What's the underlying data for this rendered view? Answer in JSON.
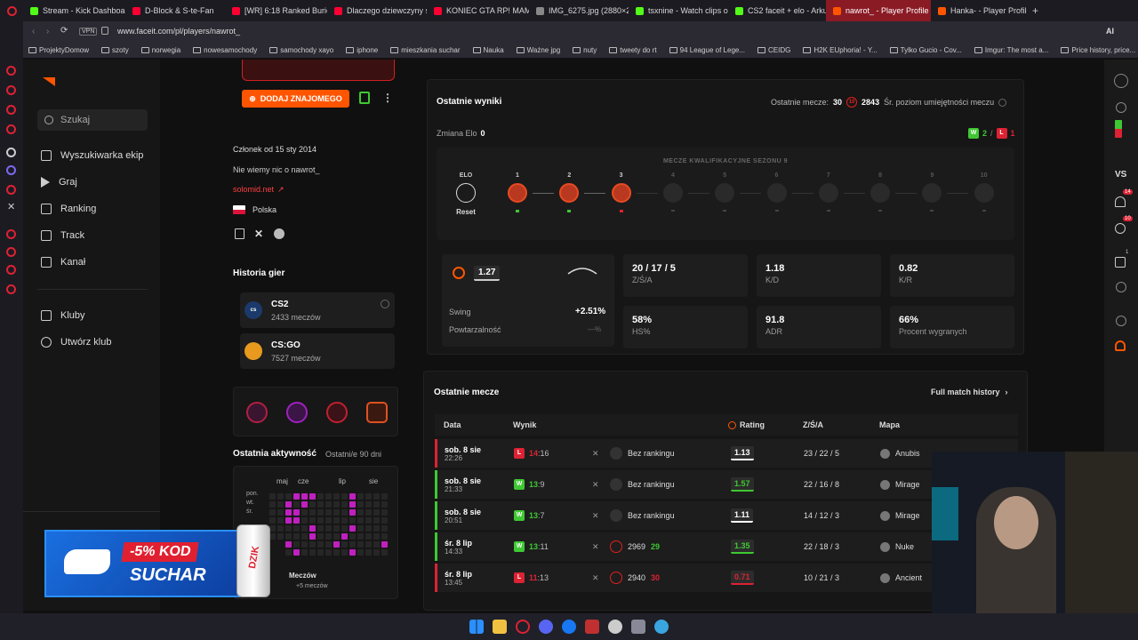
{
  "browser": {
    "tabs": [
      {
        "label": "Stream - Kick Dashboard",
        "color": "#53fc18"
      },
      {
        "label": "D-Block & S-te-Fan",
        "color": "#ff0033"
      },
      {
        "label": "[WR] 6:18 Ranked Buried",
        "color": "#ff0033"
      },
      {
        "label": "Dlaczego dziewczyny s",
        "color": "#ff0033"
      },
      {
        "label": "KONIEC GTA RP! MAMM",
        "color": "#ff0033"
      },
      {
        "label": "IMG_6275.jpg (2880×21",
        "color": "#888888"
      },
      {
        "label": "tsxnine - Watch clips on",
        "color": "#53fc18"
      },
      {
        "label": "CS2 faceit + elo - Arku",
        "color": "#53fc18"
      },
      {
        "label": "nawrot_ - Player Profile - F",
        "color": "#ff5500",
        "active": true
      },
      {
        "label": "Hanka- - Player Profile -",
        "color": "#ff5500"
      }
    ],
    "url": "www.faceit.com/pl/players/nawrot_",
    "vpn": "VPN",
    "bookmarks": [
      "ProjektyDomow",
      "szoty",
      "norwegia",
      "nowesamochody",
      "samochody xayo",
      "iphone",
      "mieszkania suchar",
      "Nauka",
      "Ważne jpg",
      "nuty",
      "tweety do rt",
      "94 League of Lege...",
      "CEIDG",
      "H2K EUphoria! - Y...",
      "Tylko Gucio - Cov...",
      "Imgur: The most a...",
      "Price history, price..."
    ],
    "right_label": "VS",
    "ai_label": "AI",
    "right_badges": [
      "14",
      "10",
      "1"
    ]
  },
  "nav": {
    "search": "Szukaj",
    "items": [
      "Wyszukiwarka ekip",
      "Graj",
      "Ranking",
      "Track",
      "Kanał"
    ],
    "club_items": [
      "Kluby",
      "Utwórz klub"
    ]
  },
  "profile": {
    "add_friend": "DODAJ ZNAJOMEGO",
    "member_since": "Członek od 15 sty 2014",
    "bio": "Nie wiemy nic o nawrot_",
    "link": "solomid.net",
    "country": "Polska",
    "games_title": "Historia gier",
    "games": [
      {
        "name": "CS2",
        "count": "2433 meczów",
        "icon": "cs2"
      },
      {
        "name": "CS:GO",
        "count": "7527 meczów",
        "icon": "csgo"
      }
    ],
    "activity_title": "Ostatnia aktywność",
    "activity_sub": "Ostatni/e 90 dni",
    "months": [
      "maj",
      "cze",
      "lip",
      "sie"
    ],
    "days": [
      "pon.",
      "wt.",
      "śr."
    ],
    "matches_label": "Meczów",
    "matches_extra": "+5 meczów"
  },
  "recent_results": {
    "title": "Ostatnie wyniki",
    "last_matches_label": "Ostatnie mecze:",
    "last_matches_value": "30",
    "skill_level": "10",
    "skill_value": "2843",
    "skill_label": "Śr. poziom umiejętności meczu",
    "elo_change_label": "Zmiana Elo",
    "elo_change_value": "0",
    "wins": "2",
    "losses": "1",
    "season_title": "MECZE KWALIFIKACYJNE SEZONU 9",
    "elo_label": "ELO",
    "reset_label": "Reset",
    "steps": [
      "1",
      "2",
      "3",
      "4",
      "5",
      "6",
      "7",
      "8",
      "9",
      "10"
    ],
    "rating": "1.27",
    "swing_label": "Swing",
    "swing_value": "+2.51%",
    "consistency_label": "Powtarzalność",
    "consistency_value": "—%",
    "stats": [
      {
        "value": "20 / 17 / 5",
        "label": "Z/Ś/A"
      },
      {
        "value": "1.18",
        "label": "K/D"
      },
      {
        "value": "0.82",
        "label": "K/R"
      },
      {
        "value": "58%",
        "label": "HS%"
      },
      {
        "value": "91.8",
        "label": "ADR"
      },
      {
        "value": "66%",
        "label": "Procent wygranych"
      }
    ]
  },
  "recent_matches": {
    "title": "Ostatnie mecze",
    "history_link": "Full match history",
    "columns": [
      "Data",
      "Wynik",
      "Rating",
      "Z/Ś/A",
      "Mapa"
    ],
    "rows": [
      {
        "date": "sob. 8 sie",
        "time": "22:26",
        "result": "L",
        "score_a": "14",
        "score_b": "16",
        "rank": "Bez rankingu",
        "elo_change": "",
        "rating": "1.13",
        "kda": "23 / 22 / 5",
        "map": "Anubis",
        "win": false
      },
      {
        "date": "sob. 8 sie",
        "time": "21:33",
        "result": "W",
        "score_a": "13",
        "score_b": "9",
        "rank": "Bez rankingu",
        "elo_change": "",
        "rating": "1.57",
        "kda": "22 / 16 / 8",
        "map": "Mirage",
        "win": true
      },
      {
        "date": "sob. 8 sie",
        "time": "20:51",
        "result": "W",
        "score_a": "13",
        "score_b": "7",
        "rank": "Bez rankingu",
        "elo_change": "",
        "rating": "1.11",
        "kda": "14 / 12 / 3",
        "map": "Mirage",
        "win": true
      },
      {
        "date": "śr. 8 lip",
        "time": "14:33",
        "result": "W",
        "score_a": "13",
        "score_b": "11",
        "rank": "2969",
        "elo_change": "29",
        "rating": "1.35",
        "kda": "22 / 18 / 3",
        "map": "Nuke",
        "win": true
      },
      {
        "date": "śr. 8 lip",
        "time": "13:45",
        "result": "L",
        "score_a": "11",
        "score_b": "13",
        "rank": "2940",
        "elo_change": "30",
        "rating": "0.71",
        "kda": "10 / 21 / 3",
        "map": "Ancient",
        "win": false
      }
    ]
  },
  "overlay": {
    "discount": "-5% KOD",
    "code": "SUCHAR",
    "can": "DZIK"
  },
  "colors": {
    "accent": "#ff5500",
    "win": "#3fc832",
    "loss": "#dd2233"
  }
}
